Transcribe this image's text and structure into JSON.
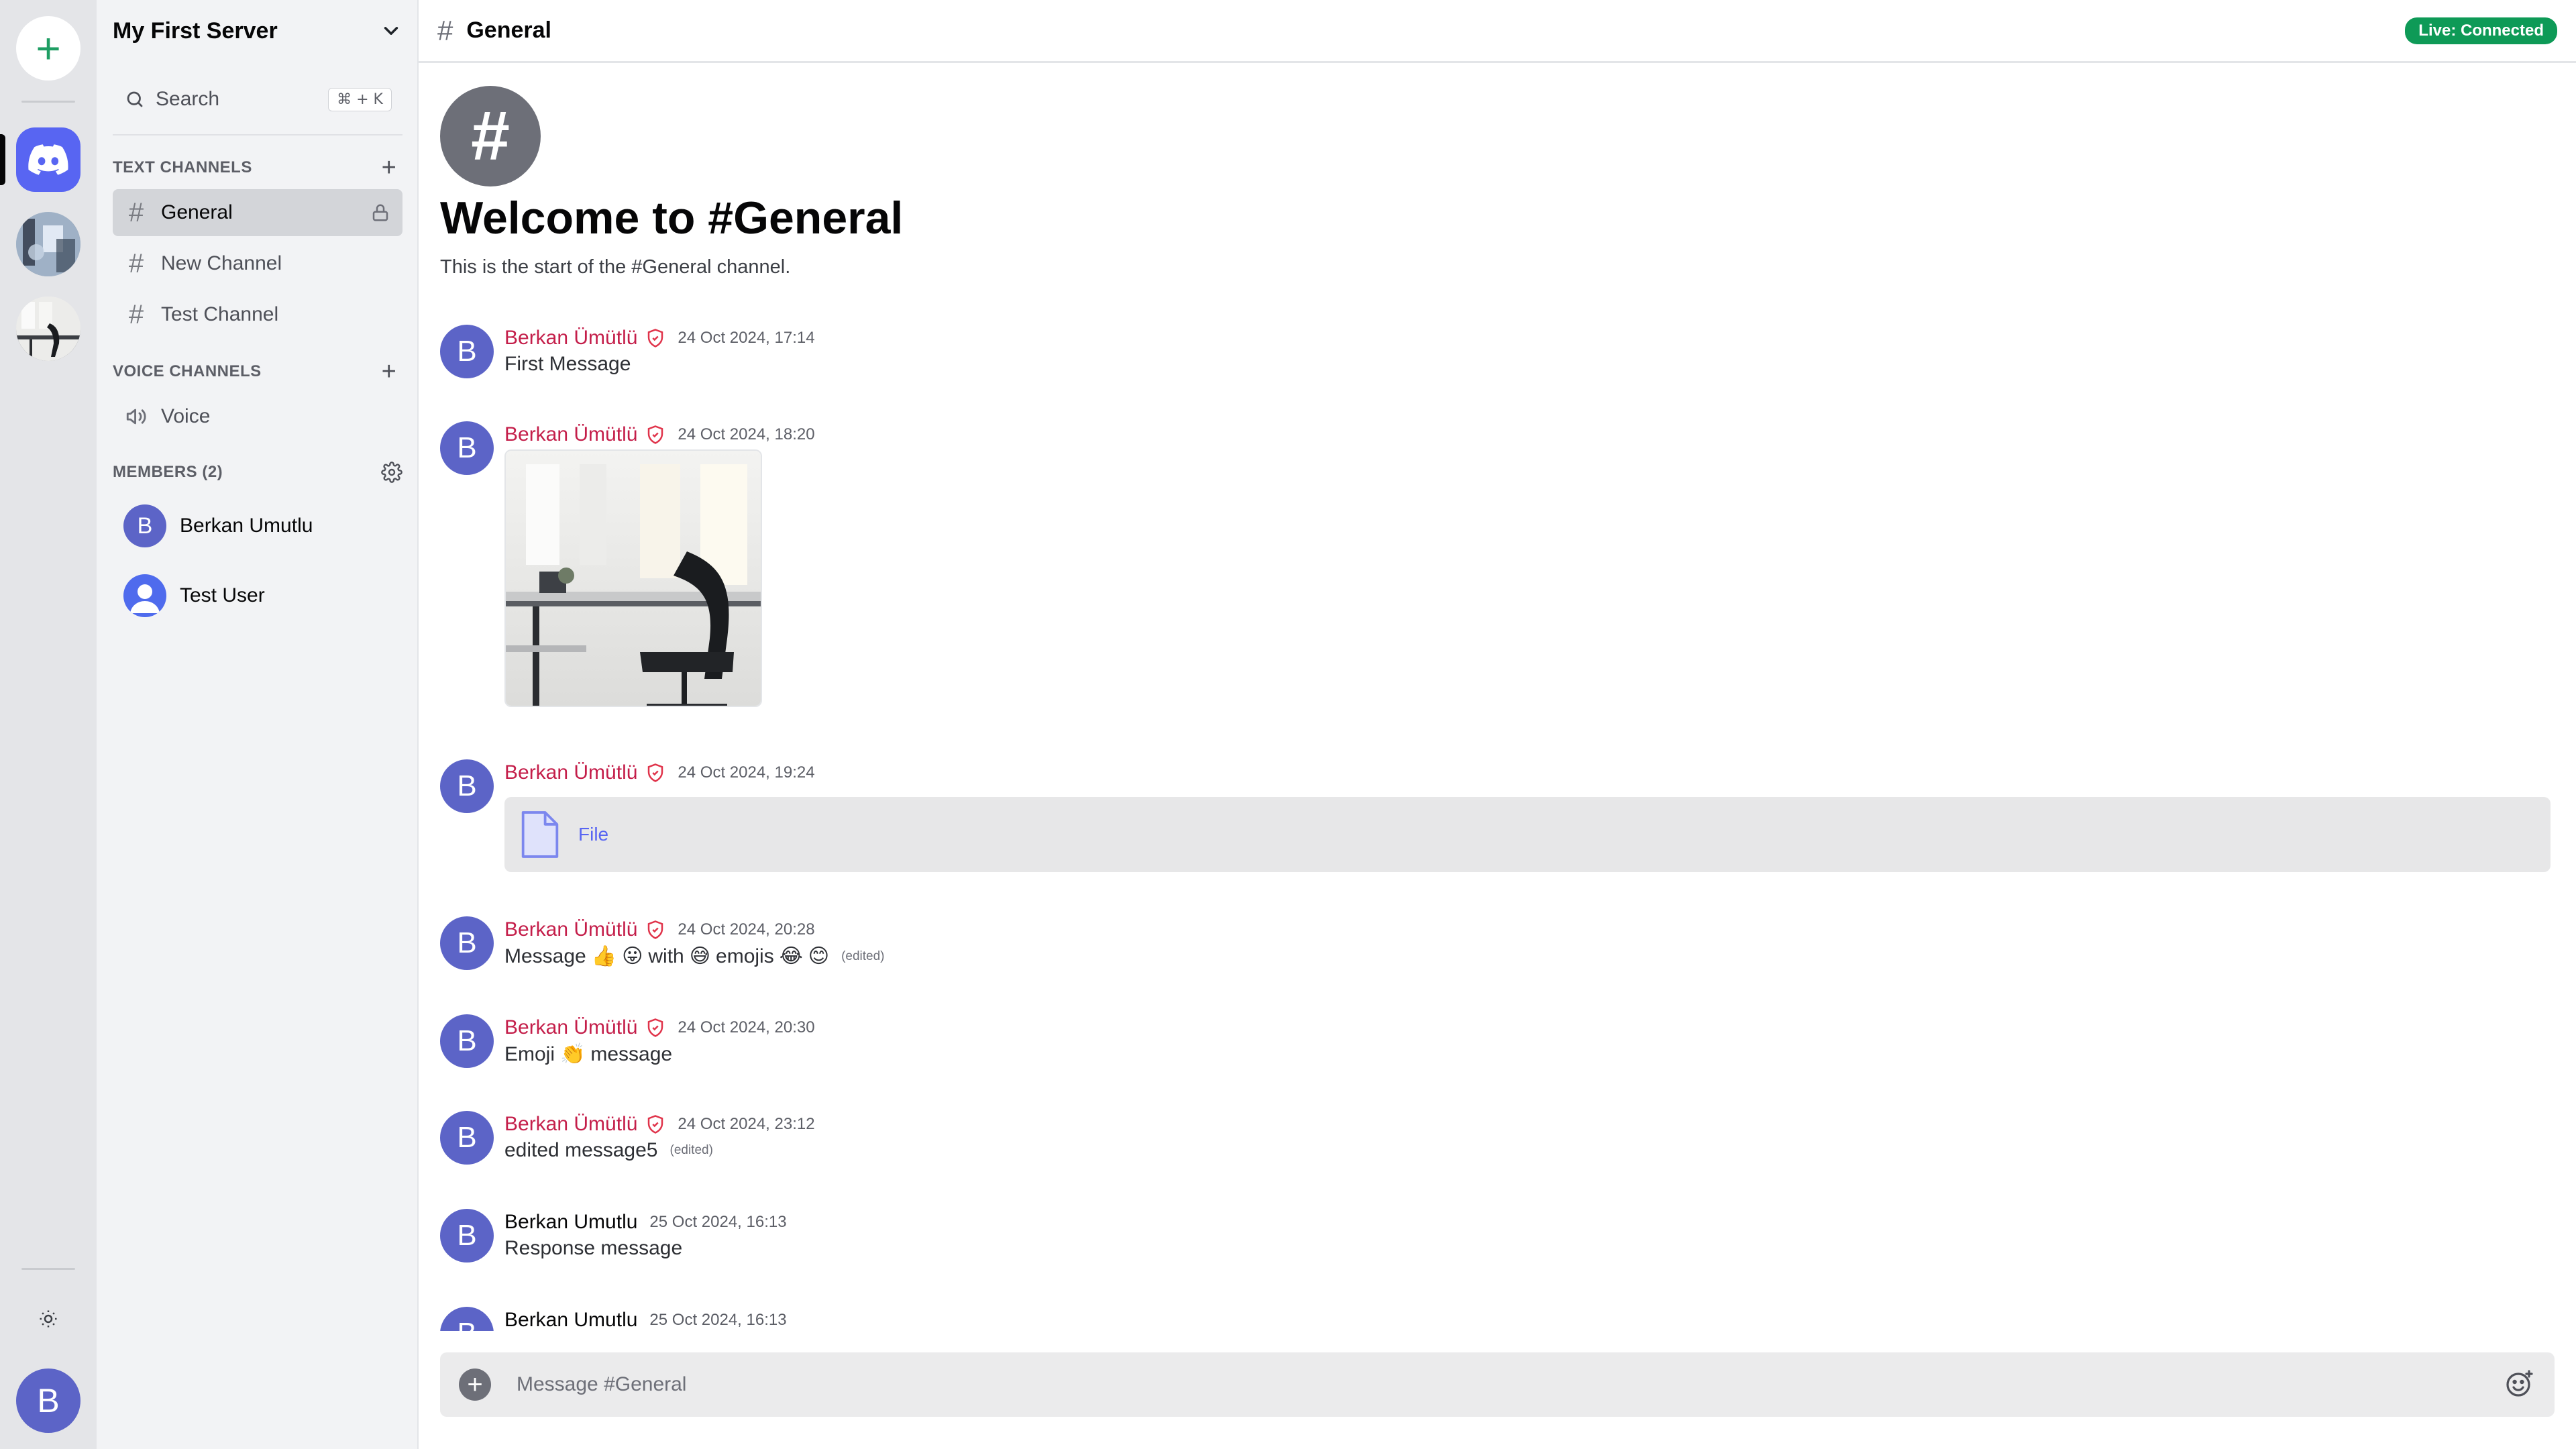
{
  "servers": {
    "add_label": "+",
    "user_initial": "B"
  },
  "sidebar": {
    "server_name": "My First Server",
    "search_label": "Search",
    "search_shortcut": "⌘ + K",
    "text_channels_heading": "TEXT CHANNELS",
    "text_channels": [
      {
        "name": "General",
        "active": true,
        "locked": true
      },
      {
        "name": "New Channel"
      },
      {
        "name": "Test Channel"
      }
    ],
    "voice_channels_heading": "VOICE CHANNELS",
    "voice_channels": [
      {
        "name": "Voice"
      }
    ],
    "members_heading": "MEMBERS (2)",
    "members": [
      {
        "initial": "B",
        "name": "Berkan Umutlu"
      },
      {
        "name": "Test User"
      }
    ]
  },
  "header": {
    "channel_name": "General",
    "status": "Live: Connected",
    "status_color": "#0e9a57"
  },
  "welcome": {
    "title": "Welcome to #General",
    "subtitle": "This is the start of the #General channel."
  },
  "messages": [
    {
      "initial": "B",
      "author": "Berkan Ümütlü",
      "time": "24 Oct 2024, 17:14",
      "text": "First Message"
    },
    {
      "initial": "B",
      "author": "Berkan Ümütlü",
      "time": "24 Oct 2024, 18:20"
    },
    {
      "initial": "B",
      "author": "Berkan Ümütlü",
      "time": "24 Oct 2024, 19:24",
      "file_label": "File"
    },
    {
      "initial": "B",
      "author": "Berkan Ümütlü",
      "time": "24 Oct 2024, 20:28",
      "text_parts": [
        "Message",
        "👍",
        "😛",
        "with",
        "😅",
        "emojis",
        "😂",
        "😊"
      ],
      "edited": "(edited)"
    },
    {
      "initial": "B",
      "author": "Berkan Ümütlü",
      "time": "24 Oct 2024, 20:30",
      "text_parts": [
        "Emoji",
        "👏",
        "message"
      ]
    },
    {
      "initial": "B",
      "author": "Berkan Ümütlü",
      "time": "24 Oct 2024, 23:12",
      "text": "edited message5",
      "edited": "(edited)"
    },
    {
      "initial": "B",
      "author": "Berkan Umutlu",
      "time": "25 Oct 2024, 16:13",
      "text": "Response message"
    },
    {
      "initial": "B",
      "author": "Berkan Umutlu",
      "time": "25 Oct 2024, 16:13"
    }
  ],
  "composer": {
    "placeholder": "Message #General"
  },
  "colors": {
    "accent": "#5865f2",
    "admin_author": "#c41e4a"
  }
}
